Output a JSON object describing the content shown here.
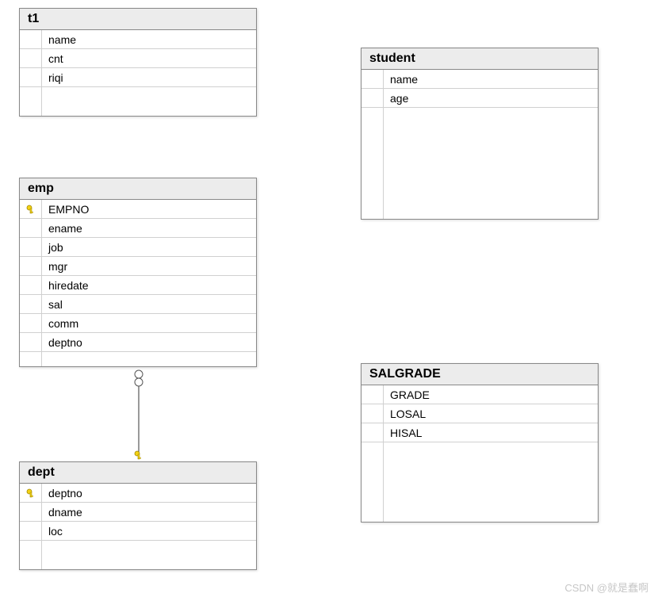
{
  "tables": {
    "t1": {
      "name": "t1",
      "columns": [
        {
          "name": "name",
          "pk": false
        },
        {
          "name": "cnt",
          "pk": false
        },
        {
          "name": "riqi",
          "pk": false
        }
      ]
    },
    "student": {
      "name": "student",
      "columns": [
        {
          "name": "name",
          "pk": false
        },
        {
          "name": "age",
          "pk": false
        }
      ]
    },
    "emp": {
      "name": "emp",
      "columns": [
        {
          "name": "EMPNO",
          "pk": true
        },
        {
          "name": "ename",
          "pk": false
        },
        {
          "name": "job",
          "pk": false
        },
        {
          "name": "mgr",
          "pk": false
        },
        {
          "name": "hiredate",
          "pk": false
        },
        {
          "name": "sal",
          "pk": false
        },
        {
          "name": "comm",
          "pk": false
        },
        {
          "name": "deptno",
          "pk": false
        }
      ]
    },
    "salgrade": {
      "name": "SALGRADE",
      "columns": [
        {
          "name": "GRADE",
          "pk": false
        },
        {
          "name": "LOSAL",
          "pk": false
        },
        {
          "name": "HISAL",
          "pk": false
        }
      ]
    },
    "dept": {
      "name": "dept",
      "columns": [
        {
          "name": "deptno",
          "pk": true
        },
        {
          "name": "dname",
          "pk": false
        },
        {
          "name": "loc",
          "pk": false
        }
      ]
    }
  },
  "watermark": "CSDN @就是蠢啊"
}
